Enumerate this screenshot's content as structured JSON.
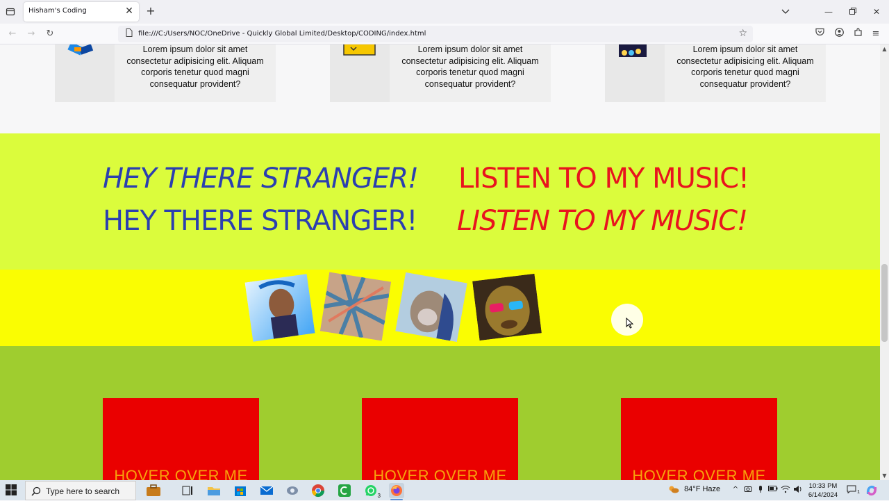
{
  "browser": {
    "tab_title": "Hisham's Coding",
    "url": "file:///C:/Users/NOC/OneDrive - Quickly Global Limited/Desktop/CODING/index.html"
  },
  "features": [
    {
      "text": "Lorem ipsum dolor sit amet consectetur adipisicing elit. Aliquam corporis tenetur quod magni consequatur provident?"
    },
    {
      "text": "Lorem ipsum dolor sit amet consectetur adipisicing elit. Aliquam corporis tenetur quod magni consequatur provident?"
    },
    {
      "text": "Lorem ipsum dolor sit amet consectetur adipisicing elit. Aliquam corporis tenetur quod magni consequatur provident?"
    }
  ],
  "hero": {
    "line1_left": "HEY THERE STRANGER!",
    "line1_right": "LISTEN TO MY MUSIC!",
    "line2_left": "HEY THERE STRANGER!",
    "line2_right": "LISTEN TO MY MUSIC!"
  },
  "hover_boxes": [
    {
      "label": "HOVER OVER ME"
    },
    {
      "label": "HOVER OVER ME"
    },
    {
      "label": "HOVER OVER ME"
    }
  ],
  "taskbar": {
    "search_placeholder": "Type here to search",
    "whatsapp_badge": "3",
    "weather": "84°F  Haze",
    "notification_count": "1",
    "time": "10:33 PM",
    "date": "6/14/2024"
  },
  "colors": {
    "hero_bg": "#dbfc3c",
    "gallery_bg": "#fafd02",
    "green_bg": "#9fcd2f",
    "hover_box": "#ea0000",
    "hover_text": "#f7a20c",
    "blue_text": "#2b3fb0",
    "red_text": "#e8141e"
  }
}
